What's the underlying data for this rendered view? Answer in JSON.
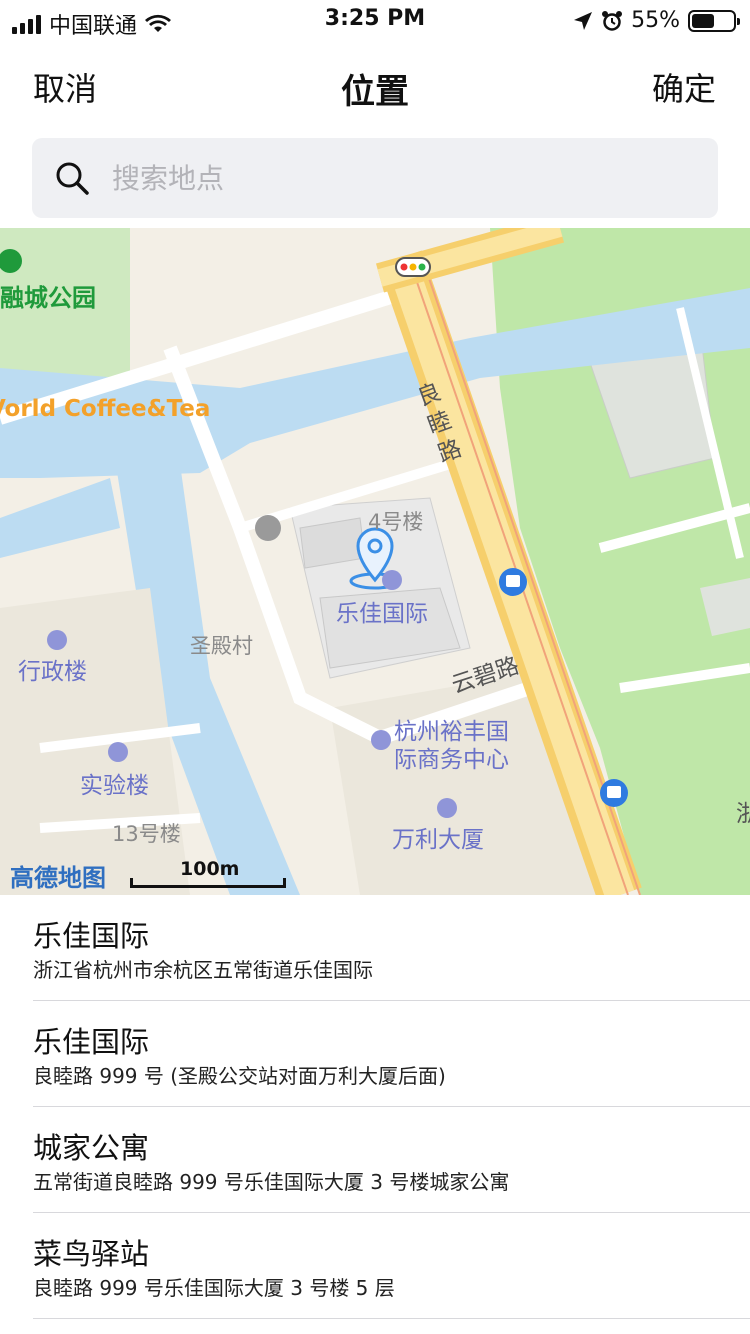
{
  "status_bar": {
    "carrier": "中国联通",
    "time": "3:25 PM",
    "battery": "55%",
    "battery_level": 0.55
  },
  "nav": {
    "cancel_label": "取消",
    "title": "位置",
    "confirm_label": "确定"
  },
  "search": {
    "placeholder": "搜索地点",
    "value": ""
  },
  "map": {
    "labels": {
      "park": "融城公园",
      "coffee": "Vorld Coffee&Tea",
      "liangmu_road": "良睦路",
      "building4": "4号楼",
      "lejia": "乐佳国际",
      "shengdian": "圣殿村",
      "admin_building": "行政楼",
      "yunbi_road": "云碧路",
      "yufeng_line1": "杭州裕丰国",
      "yufeng_line2": "际商务中心",
      "lab_building": "实验楼",
      "building13": "13号楼",
      "wanli": "万利大厦",
      "edge_char": "浙"
    },
    "logo": "高德地图",
    "scale": "100m"
  },
  "results": [
    {
      "title": "乐佳国际",
      "address": "浙江省杭州市余杭区五常街道乐佳国际"
    },
    {
      "title": "乐佳国际",
      "address": "良睦路 999 号 (圣殿公交站对面万利大厦后面)"
    },
    {
      "title": "城家公寓",
      "address": "五常街道良睦路 999 号乐佳国际大厦 3 号楼城家公寓"
    },
    {
      "title": "菜鸟驿站",
      "address": "良睦路 999 号乐佳国际大厦 3 号楼 5 层"
    }
  ],
  "colors": {
    "water": "#bcdcf2",
    "park": "#bfe7a8",
    "road_main": "#f7d87a",
    "poi": "#6a72c8",
    "accent_pin": "#3b8fe6"
  }
}
